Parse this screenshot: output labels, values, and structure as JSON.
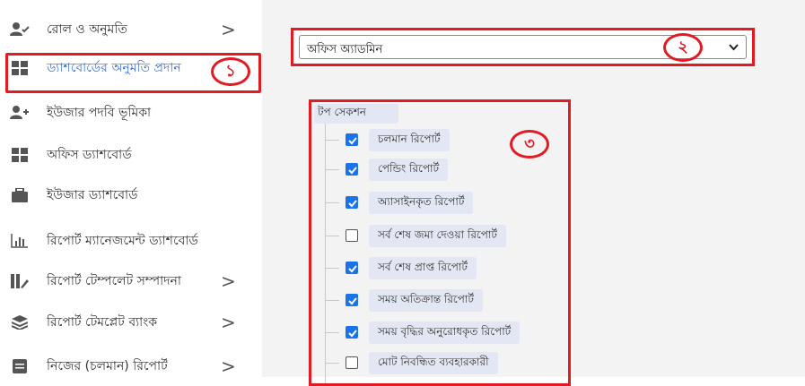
{
  "sidebar": {
    "items": [
      {
        "label": "রোল ও অনুমতি",
        "icon": "user-check-icon",
        "has_chevron": true
      },
      {
        "label": "ড্যাশবোর্ডের অনুমতি প্রদান",
        "icon": "dashboard-grid-icon",
        "active": true
      },
      {
        "label": "ইউজার পদবি ভূমিকা",
        "icon": "user-add-icon"
      },
      {
        "label": "অফিস ড্যাশবোর্ড",
        "icon": "dashboard-grid-icon"
      },
      {
        "label": "ইউজার ড্যাশবোর্ড",
        "icon": "briefcase-icon"
      },
      {
        "label": "রিপোর্ট ম্যানেজমেন্ট ড্যাশবোর্ড",
        "icon": "bar-chart-icon"
      },
      {
        "label": "রিপোর্ট টেম্পলেট সম্পাদনা",
        "icon": "template-edit-icon",
        "has_chevron": true
      },
      {
        "label": "রিপোর্ট টেমপ্লেট ব্যাংক",
        "icon": "layers-icon",
        "has_chevron": true
      },
      {
        "label": "নিজের (চলমান) রিপোর্ট",
        "icon": "report-icon",
        "has_chevron": true
      }
    ],
    "chevron": ">"
  },
  "annotations": {
    "marker_1": "১",
    "marker_2": "২",
    "marker_3": "৩"
  },
  "office_select": {
    "value": "অফিস অ্যাডমিন"
  },
  "tree": {
    "title": "টপ সেকশন",
    "items": [
      {
        "label": "চলমান রিপোর্ট",
        "checked": true
      },
      {
        "label": "পেন্ডিং রিপোর্ট",
        "checked": true
      },
      {
        "label": "অ্যাসাইনকৃত রিপোর্ট",
        "checked": true
      },
      {
        "label": "সর্ব শেষ জমা দেওয়া রিপোর্ট",
        "checked": false
      },
      {
        "label": "সর্ব শেষ প্রাপ্ত রিপোর্ট",
        "checked": true
      },
      {
        "label": "সময় অতিক্রান্ত রিপোর্ট",
        "checked": true
      },
      {
        "label": "সময় বৃদ্ধির অনুরোধকৃত রিপোর্ট",
        "checked": true
      },
      {
        "label": "মোট নিবন্ধিত ব্যবহারকারী",
        "checked": false
      }
    ]
  },
  "colors": {
    "accent": "#1a73e8",
    "annotation": "#e21b23",
    "active_link": "#3a6fd8"
  }
}
